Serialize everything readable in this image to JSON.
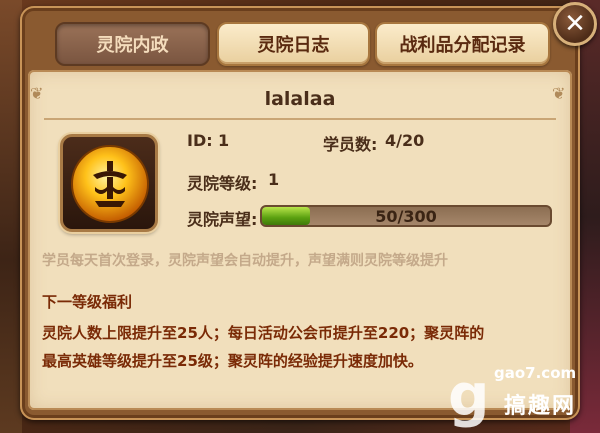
{
  "tabs": [
    {
      "label": "灵院内政",
      "active": true
    },
    {
      "label": "灵院日志",
      "active": false
    },
    {
      "label": "战利品分配记录",
      "active": false
    }
  ],
  "close_icon": "close-icon",
  "guild": {
    "name": "lalalaa",
    "id_label": "ID:",
    "id_value": "1",
    "members_label": "学员数:",
    "members_value": "4/20",
    "level_label": "灵院等级:",
    "level_value": "1",
    "reputation_label": "灵院声望:",
    "reputation_text": "50/300",
    "reputation_fraction": 0.1667,
    "emblem_icon": "guild-emblem-icon"
  },
  "hint": "学员每天首次登录，灵院声望会自动提升，声望满则灵院等级提升",
  "benefits": {
    "title": "下一等级福利",
    "lines": [
      "灵院人数上限提升至25人；每日活动公会币提升至220；聚灵阵的",
      "最高英雄等级提升至25级；聚灵阵的经验提升速度加快。"
    ]
  },
  "watermark": {
    "glyph": "g",
    "site": "gao7.com",
    "brand": "搞趣网"
  },
  "colors": {
    "accent_text": "#7a2a06",
    "bar_fill": "#5aa010",
    "panel_bg": "#f1dfbc"
  }
}
